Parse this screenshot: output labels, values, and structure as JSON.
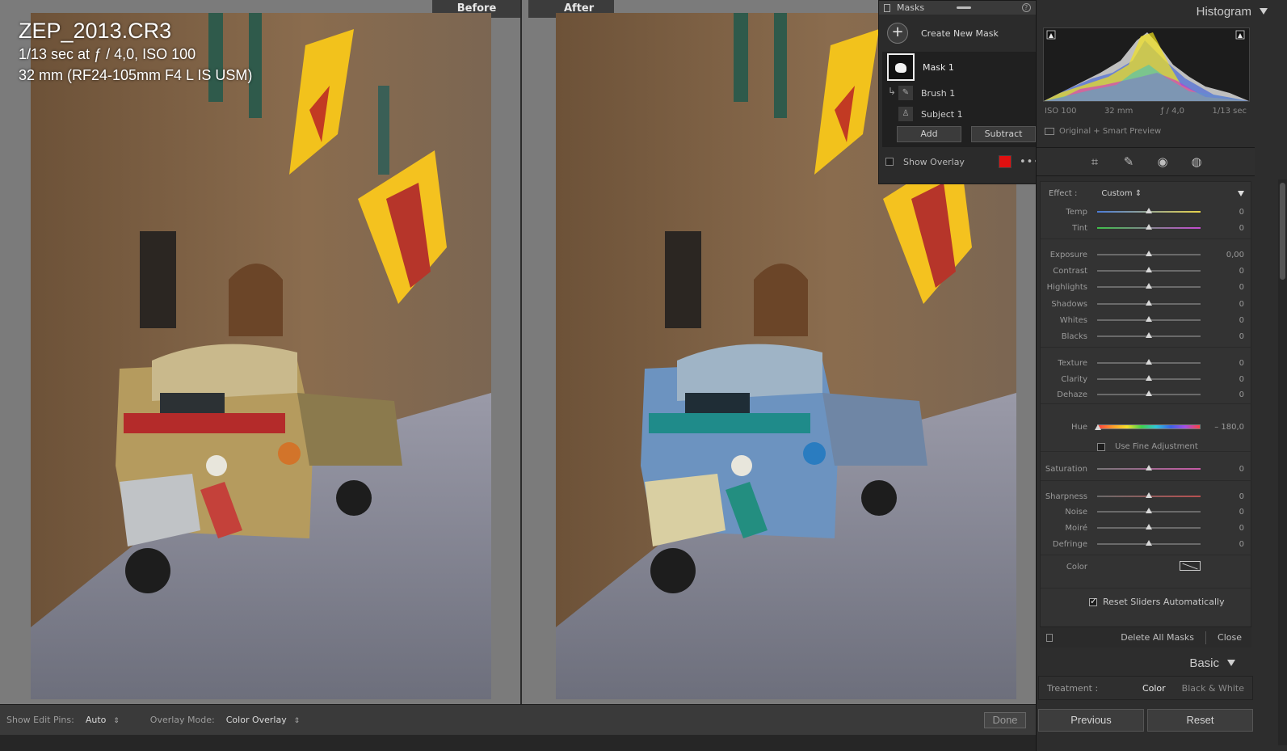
{
  "photo": {
    "filename": "ZEP_2013.CR3",
    "exposure": "1/13 sec at ƒ / 4,0, ISO 100",
    "lens": "32 mm (RF24-105mm F4 L IS USM)"
  },
  "compare": {
    "before_label": "Before",
    "after_label": "After"
  },
  "masks": {
    "title": "Masks",
    "create_label": "Create New Mask",
    "mask_name": "Mask 1",
    "components": [
      {
        "label": "Brush 1",
        "icon": "brush-icon"
      },
      {
        "label": "Subject 1",
        "icon": "subject-icon"
      }
    ],
    "add_label": "Add",
    "subtract_label": "Subtract",
    "show_overlay_label": "Show Overlay",
    "overlay_color": "#e01010"
  },
  "histogram": {
    "title": "Histogram",
    "iso": "ISO 100",
    "focal": "32 mm",
    "aperture": "ƒ / 4,0",
    "shutter": "1/13 sec",
    "preview_label": "Original + Smart Preview"
  },
  "tools": [
    "crop-icon",
    "heal-icon",
    "redeye-icon",
    "mask-icon"
  ],
  "effect": {
    "label": "Effect :",
    "value": "Custom",
    "sliders": [
      {
        "label": "Temp",
        "value": "0",
        "pos": 0.5
      },
      {
        "label": "Tint",
        "value": "0",
        "pos": 0.5
      },
      {
        "label": "Exposure",
        "value": "0,00",
        "pos": 0.5
      },
      {
        "label": "Contrast",
        "value": "0",
        "pos": 0.5
      },
      {
        "label": "Highlights",
        "value": "0",
        "pos": 0.5
      },
      {
        "label": "Shadows",
        "value": "0",
        "pos": 0.5
      },
      {
        "label": "Whites",
        "value": "0",
        "pos": 0.5
      },
      {
        "label": "Blacks",
        "value": "0",
        "pos": 0.5
      },
      {
        "label": "Texture",
        "value": "0",
        "pos": 0.5
      },
      {
        "label": "Clarity",
        "value": "0",
        "pos": 0.5
      },
      {
        "label": "Dehaze",
        "value": "0",
        "pos": 0.5
      },
      {
        "label": "Hue",
        "value": "– 180,0",
        "pos": 0.0
      },
      {
        "label": "Saturation",
        "value": "0",
        "pos": 0.5
      },
      {
        "label": "Sharpness",
        "value": "0",
        "pos": 0.5
      },
      {
        "label": "Noise",
        "value": "0",
        "pos": 0.5
      },
      {
        "label": "Moiré",
        "value": "0",
        "pos": 0.5
      },
      {
        "label": "Defringe",
        "value": "0",
        "pos": 0.5
      }
    ],
    "fine_adjust_label": "Use Fine Adjustment",
    "color_label": "Color",
    "reset_label": "Reset Sliders Automatically"
  },
  "mask_footer": {
    "delete_label": "Delete All Masks",
    "close_label": "Close"
  },
  "basic": {
    "title": "Basic",
    "treatment_label": "Treatment :",
    "treatment_color": "Color",
    "treatment_bw": "Black & White"
  },
  "buttons": {
    "previous": "Previous",
    "reset": "Reset"
  },
  "toolbar": {
    "edit_pins_label": "Show Edit Pins:",
    "edit_pins_value": "Auto",
    "overlay_mode_label": "Overlay Mode:",
    "overlay_mode_value": "Color Overlay",
    "done_label": "Done"
  }
}
